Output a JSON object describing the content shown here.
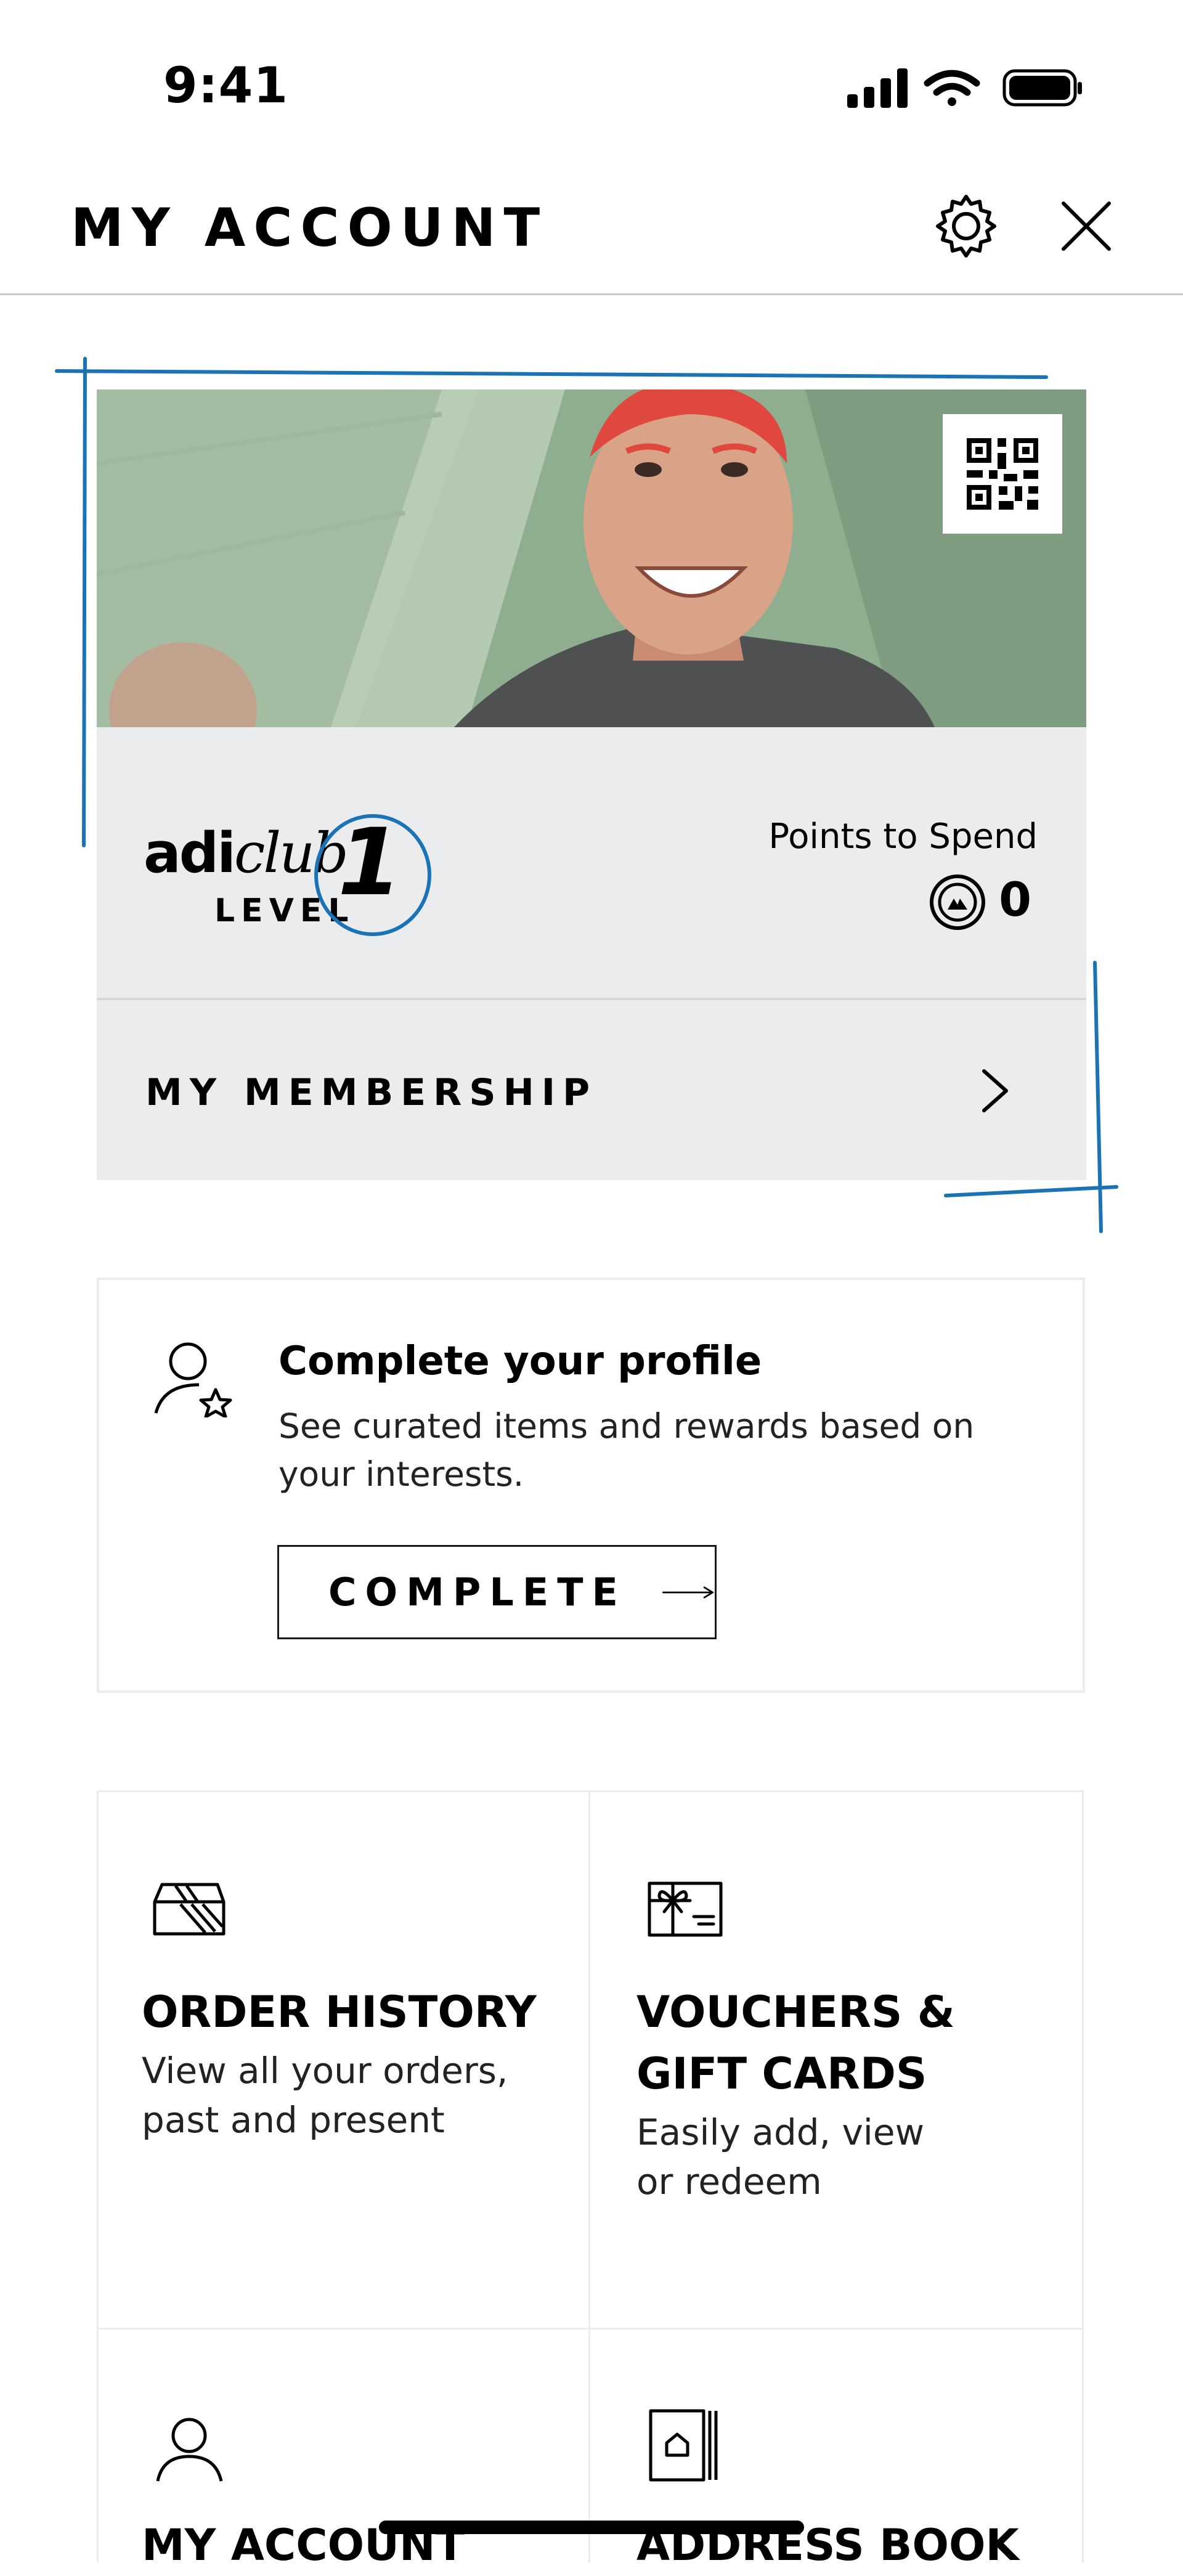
{
  "status_bar": {
    "time": "9:41"
  },
  "header": {
    "title": "MY ACCOUNT",
    "settings_icon": "gear-icon",
    "close_icon": "close-icon"
  },
  "membership_card": {
    "qr_icon": "qr-code-icon",
    "program_name_prefix": "adi",
    "program_name_suffix": "club",
    "level_label": "LEVEL",
    "level_number": "1",
    "points_label": "Points to Spend",
    "points_value": "0",
    "membership_label": "MY MEMBERSHIP"
  },
  "profile_prompt": {
    "title": "Complete your profile",
    "description": "See curated items and rewards based on your interests.",
    "button_label": "COMPLETE"
  },
  "tiles": [
    {
      "icon": "box-icon",
      "title": "ORDER HISTORY",
      "description": "View all your orders, past and present"
    },
    {
      "icon": "gift-card-icon",
      "title": "VOUCHERS & GIFT CARDS",
      "description": "Easily add, view or redeem"
    },
    {
      "icon": "person-icon",
      "title": "MY ACCOUNT",
      "description": ""
    },
    {
      "icon": "address-book-icon",
      "title": "ADDRESS BOOK",
      "description": ""
    }
  ],
  "colors": {
    "annotation_blue": "#1a73b5",
    "card_grey": "#ebecee",
    "photo_green": "#8aa58a"
  }
}
